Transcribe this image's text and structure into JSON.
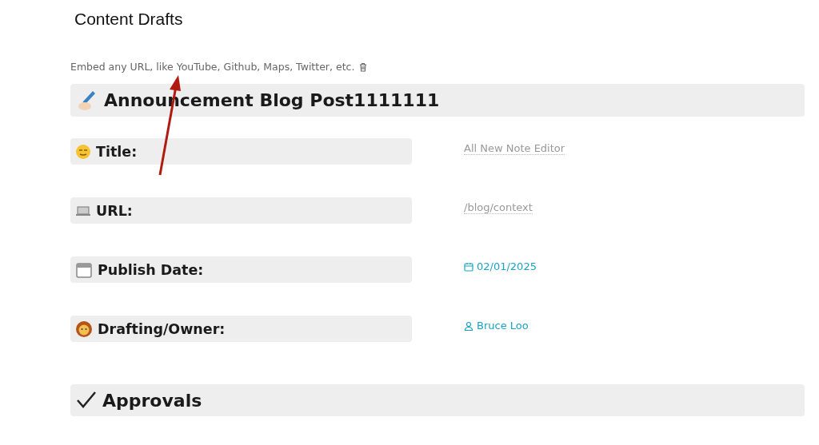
{
  "page_title": "Content Drafts",
  "embed_hint": "Embed any URL, like YouTube, Github, Maps, Twitter, etc.",
  "heading": "Announcement Blog Post1111111",
  "properties": [
    {
      "label": "Title:",
      "kind": "text",
      "value": "All New Note Editor"
    },
    {
      "label": "URL:",
      "kind": "text",
      "value": "/blog/context"
    },
    {
      "label": "Publish Date:",
      "kind": "date",
      "value": "02/01/2025"
    },
    {
      "label": "Drafting/Owner:",
      "kind": "person",
      "value": "Bruce Loo"
    }
  ],
  "section": "Approvals"
}
